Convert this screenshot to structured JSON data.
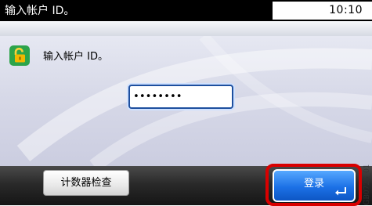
{
  "header": {
    "title": "输入帐户 ID。",
    "time": "10:10"
  },
  "main": {
    "prompt": "输入帐户 ID。",
    "password_value": "********",
    "lock_icon": "unlock-icon"
  },
  "footer": {
    "counter_check_label": "计数器检查",
    "login_label": "登录",
    "enter_icon": "enter-icon"
  },
  "figure_id": "GB0725_01",
  "colors": {
    "accent": "#1c71e6",
    "highlight": "#d90000",
    "lock": "#f2a700"
  }
}
